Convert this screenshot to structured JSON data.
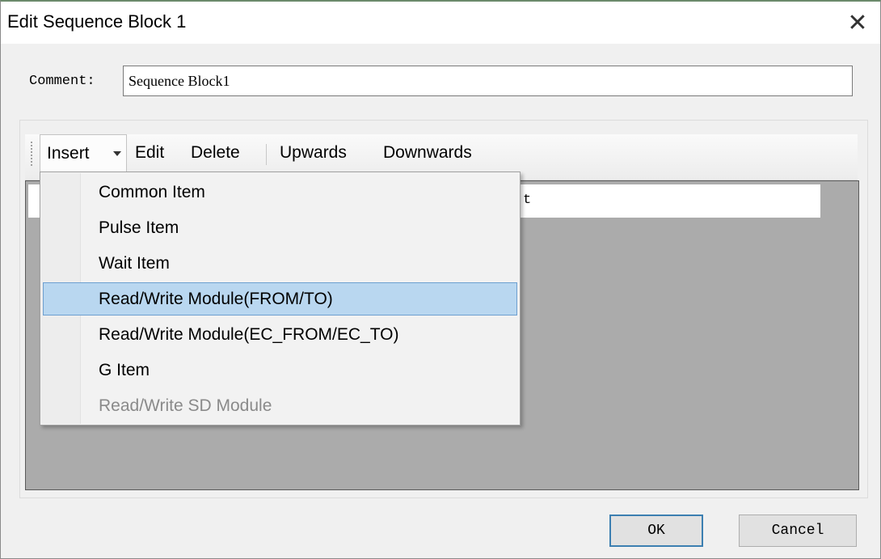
{
  "window": {
    "title": "Edit Sequence Block 1",
    "close_glyph": "✕"
  },
  "comment": {
    "label": "Comment:",
    "value": "Sequence Block1"
  },
  "toolbar": {
    "insert_label": "Insert",
    "edit_label": "Edit",
    "delete_label": "Delete",
    "upwards_label": "Upwards",
    "downwards_label": "Downwards"
  },
  "list": {
    "row_partial_text": "t"
  },
  "insert_menu": {
    "items": [
      {
        "label": "Common Item"
      },
      {
        "label": "Pulse Item"
      },
      {
        "label": "Wait Item"
      },
      {
        "label": "Read/Write Module(FROM/TO)"
      },
      {
        "label": "Read/Write Module(EC_FROM/EC_TO)"
      },
      {
        "label": "G Item"
      },
      {
        "label": "Read/Write SD Module"
      }
    ],
    "highlighted_index": 3,
    "disabled_index": 6
  },
  "buttons": {
    "ok_label": "OK",
    "cancel_label": "Cancel"
  },
  "colors": {
    "highlight": "#b9d7f0",
    "highlight_border": "#6d9fd0",
    "list_bg": "#ababab"
  }
}
